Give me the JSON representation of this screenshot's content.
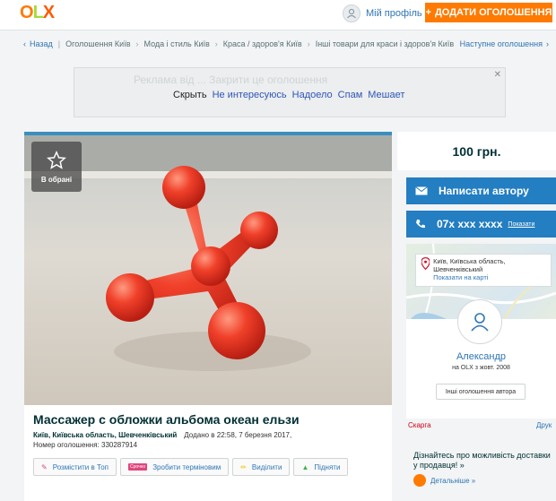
{
  "header": {
    "logo": "OLX",
    "profile_label": "Мій профіль",
    "add_button": "ДОДАТИ ОГОЛОШЕННЯ",
    "add_icon": "plus-icon"
  },
  "breadcrumb": {
    "back": "Назад",
    "items": [
      "Оголошення Київ",
      "Мода і стиль Київ",
      "Краса / здоров'я Київ",
      "Інші товари для краси і здоров'я Київ"
    ],
    "next": "Наступне оголошення"
  },
  "ad_banner": {
    "faded_text": "Реклама від ... Закрити це оголошення",
    "hide": "Скрыть",
    "options": [
      "Не интересуюсь",
      "Надоело",
      "Спам",
      "Мешает"
    ]
  },
  "listing": {
    "favorite_label": "В обрані",
    "title": "Массажер с обложки альбома океан ельзи",
    "location": "Київ, Київська область, Шевченківський",
    "date": "Додано в 22:58, 7 березня 2017,",
    "ad_number": "Номер оголошення: 330287914",
    "promo_buttons": [
      "Розмістити в Топ",
      "Зробити терміновим",
      "Виділити",
      "Підняти"
    ],
    "promo_badge": "Срочно"
  },
  "sidebar": {
    "price": "100 грн.",
    "write_button": "Написати автору",
    "phone": "07x xxx xxxx",
    "phone_show": "Показати",
    "map_address": "Київ, Київська область, Шевченківський",
    "map_link": "Показати на карті",
    "seller_name": "Александр",
    "seller_since": "на OLX з жовт. 2008",
    "other_ads": "Інші оголошення автора",
    "complain": "Скарга",
    "print": "Друк",
    "delivery_text": "Дізнайтесь про можливість доставки у продавця! »",
    "delivery_more": "Детальніше »"
  },
  "colors": {
    "accent": "#ff7a00",
    "primary_blue": "#237ec2",
    "link": "#2f75b5",
    "complain": "#d0021b"
  }
}
